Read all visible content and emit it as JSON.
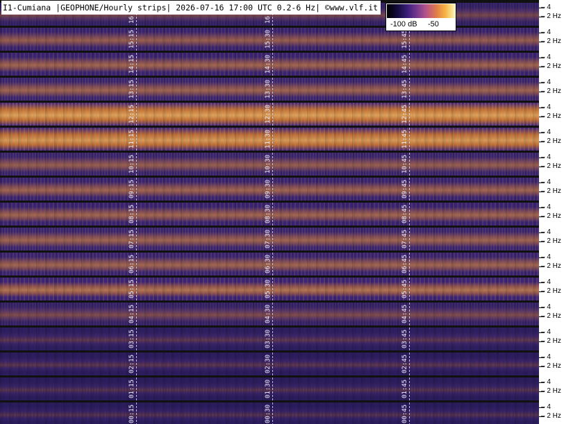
{
  "header": {
    "title": "I1-Cumiana |GEOPHONE/Hourly strips| 2026-07-16 17:00 UTC 0.2-6 Hz| ©www.vlf.it"
  },
  "colorbar": {
    "label_low": "-100 dB",
    "label_high": "-50"
  },
  "axis": {
    "tick_upper": "4",
    "tick_lower": "2 Hz"
  },
  "strips": [
    {
      "id": "s17",
      "labels": [
        "16:15",
        "16:30",
        "16:45"
      ],
      "intensity": 0.35
    },
    {
      "id": "s16",
      "labels": [
        "15:15",
        "15:30",
        "15:45"
      ],
      "intensity": 0.55
    },
    {
      "id": "s15",
      "labels": [
        "14:15",
        "14:30",
        "14:45"
      ],
      "intensity": 0.6
    },
    {
      "id": "s14",
      "labels": [
        "13:15",
        "13:30",
        "13:45"
      ],
      "intensity": 0.6
    },
    {
      "id": "s13",
      "labels": [
        "12:15",
        "12:30",
        "12:45"
      ],
      "intensity": 0.95
    },
    {
      "id": "s12",
      "labels": [
        "11:15",
        "11:30",
        "11:45"
      ],
      "intensity": 0.9
    },
    {
      "id": "s11",
      "labels": [
        "10:15",
        "10:30",
        "10:45"
      ],
      "intensity": 0.55
    },
    {
      "id": "s10",
      "labels": [
        "09:15",
        "09:30",
        "09:45"
      ],
      "intensity": 0.6
    },
    {
      "id": "s09",
      "labels": [
        "08:15",
        "08:30",
        "08:45"
      ],
      "intensity": 0.6
    },
    {
      "id": "s08",
      "labels": [
        "07:15",
        "07:30",
        "07:45"
      ],
      "intensity": 0.6
    },
    {
      "id": "s07",
      "labels": [
        "06:15",
        "06:30",
        "06:45"
      ],
      "intensity": 0.6
    },
    {
      "id": "s06",
      "labels": [
        "05:15",
        "05:30",
        "05:45"
      ],
      "intensity": 0.7
    },
    {
      "id": "s05",
      "labels": [
        "04:15",
        "04:30",
        "04:45"
      ],
      "intensity": 0.4
    },
    {
      "id": "s04",
      "labels": [
        "03:15",
        "03:30",
        "03:45"
      ],
      "intensity": 0.15
    },
    {
      "id": "s03",
      "labels": [
        "02:15",
        "02:30",
        "02:45"
      ],
      "intensity": 0.12
    },
    {
      "id": "s02",
      "labels": [
        "01:15",
        "01:30",
        "01:45"
      ],
      "intensity": 0.1
    },
    {
      "id": "s01",
      "labels": [
        "00:15",
        "00:30",
        "00:45"
      ],
      "intensity": 0.08
    }
  ],
  "colors": {
    "background_dark": "#1a1446",
    "mid": "#4a2a8a",
    "warm": "#c9722e",
    "hot": "#ffd27a",
    "gridline": "#d8d8ff"
  }
}
